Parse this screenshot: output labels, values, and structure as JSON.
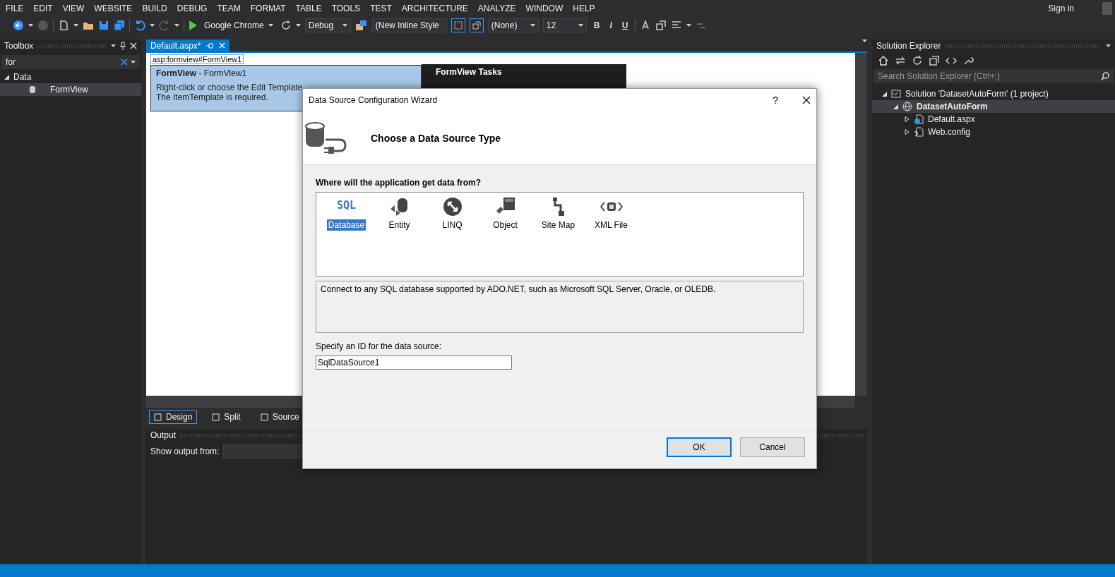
{
  "menu_bar": {
    "items": [
      "FILE",
      "EDIT",
      "VIEW",
      "WEBSITE",
      "BUILD",
      "DEBUG",
      "TEAM",
      "FORMAT",
      "TABLE",
      "TOOLS",
      "TEST",
      "ARCHITECTURE",
      "ANALYZE",
      "WINDOW",
      "HELP"
    ],
    "sign_in": "Sign in"
  },
  "toolbar": {
    "run_target": "Google Chrome",
    "configuration": "Debug",
    "style": "(New Inline Style",
    "target_rule": "(None)",
    "font_size": "12",
    "format_buttons": [
      "B",
      "I",
      "U"
    ]
  },
  "toolbox": {
    "title": "Toolbox",
    "search": "for",
    "tree": [
      {
        "label": "Data",
        "expanded": true,
        "children": [
          {
            "label": "FormView",
            "selected": true
          }
        ]
      }
    ]
  },
  "document": {
    "tabs": [
      {
        "label": "Default.aspx*",
        "selected": true
      }
    ],
    "tag_label": "asp:formview#FormView1",
    "formview": {
      "title": "FormView",
      "subtitle": " - FormView1",
      "lines": [
        "Right-click or choose the Edit Template",
        "The ItemTemplate is required."
      ]
    },
    "tasks_title": "FormView Tasks",
    "view_tabs": [
      {
        "label": "Design",
        "selected": true
      },
      {
        "label": "Split",
        "selected": false
      },
      {
        "label": "Source",
        "selected": false
      }
    ]
  },
  "output": {
    "title": "Output",
    "show_from_label": "Show output from:"
  },
  "solution_explorer": {
    "title": "Solution Explorer",
    "search_placeholder": "Search Solution Explorer (Ctrl+;)",
    "tree": [
      {
        "label": "Solution 'DatasetAutoForm' (1 project)",
        "kind": "solution",
        "expanded": true,
        "selected": false,
        "children": [
          {
            "label": "DatasetAutoForm",
            "kind": "project",
            "expanded": true,
            "selected": true,
            "children": [
              {
                "label": "Default.aspx",
                "kind": "page",
                "expanded": false,
                "selected": false
              },
              {
                "label": "Web.config",
                "kind": "config",
                "expanded": false,
                "selected": false
              }
            ]
          }
        ]
      }
    ]
  },
  "dialog": {
    "title": "Data Source Configuration Wizard",
    "help": "?",
    "heading": "Choose a Data Source Type",
    "question": "Where will the application get data from?",
    "sources": [
      {
        "label": "Database",
        "kind": "sql",
        "icon_text": "SQL",
        "selected": true
      },
      {
        "label": "Entity",
        "kind": "entity",
        "selected": false
      },
      {
        "label": "LINQ",
        "kind": "linq",
        "selected": false
      },
      {
        "label": "Object",
        "kind": "object",
        "selected": false
      },
      {
        "label": "Site Map",
        "kind": "sitemap",
        "selected": false
      },
      {
        "label": "XML File",
        "kind": "xml",
        "selected": false
      }
    ],
    "description": "Connect to any SQL database supported by ADO.NET, such as Microsoft SQL Server, Oracle, or OLEDB.",
    "id_label": "Specify an ID for the data source:",
    "id_value": "SqlDataSource1",
    "buttons": [
      {
        "label": "OK",
        "default": true
      },
      {
        "label": "Cancel",
        "default": false
      }
    ]
  }
}
